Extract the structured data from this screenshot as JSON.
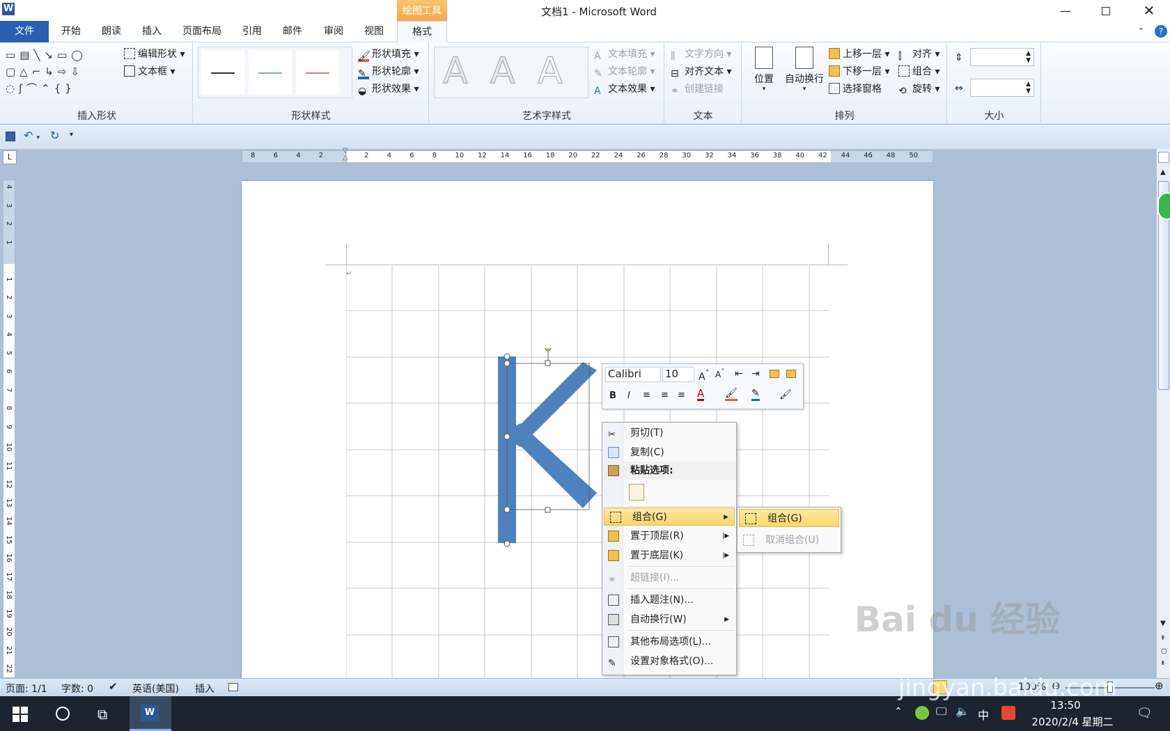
{
  "window": {
    "title": "文档1 - Microsoft Word",
    "context_tab_group": "绘图工具"
  },
  "tabs": [
    "文件",
    "开始",
    "朗读",
    "插入",
    "页面布局",
    "引用",
    "邮件",
    "审阅",
    "视图",
    "格式"
  ],
  "ribbon": {
    "insert_shapes": {
      "label": "插入形状",
      "edit_shape": "编辑形状",
      "text_box": "文本框"
    },
    "shape_styles": {
      "label": "形状样式",
      "fill": "形状填充",
      "outline": "形状轮廓",
      "effects": "形状效果"
    },
    "wordart": {
      "label": "艺术字样式",
      "glyph": "A",
      "fill": "文本填充",
      "outline": "文本轮廓",
      "effects": "文本效果"
    },
    "text": {
      "label": "文本",
      "direction": "文字方向",
      "align": "对齐文本",
      "link": "创建链接"
    },
    "arrange": {
      "label": "排列",
      "position": "位置",
      "wrap": "自动换行",
      "bring_forward": "上移一层",
      "send_backward": "下移一层",
      "selection_pane": "选择窗格",
      "align": "对齐",
      "group": "组合",
      "rotate": "旋转"
    },
    "size": {
      "label": "大小"
    }
  },
  "ruler": {
    "h_ticks": [
      "8",
      "6",
      "4",
      "2",
      "",
      "2",
      "4",
      "6",
      "8",
      "10",
      "12",
      "14",
      "16",
      "18",
      "20",
      "22",
      "24",
      "26",
      "28",
      "30",
      "32",
      "34",
      "36",
      "38",
      "40",
      "42",
      "44",
      "46",
      "48",
      "50"
    ],
    "v_ticks": [
      "4",
      "3",
      "2",
      "1",
      "",
      "1",
      "2",
      "3",
      "4",
      "5",
      "6",
      "7",
      "8",
      "9",
      "10",
      "11",
      "12",
      "13",
      "14",
      "15",
      "16",
      "17",
      "18",
      "19",
      "20",
      "21",
      "22"
    ]
  },
  "mini_toolbar": {
    "font": "Calibri",
    "size": "10"
  },
  "context_menu": {
    "items": [
      {
        "label": "剪切(T)",
        "disabled": false
      },
      {
        "label": "复制(C)",
        "disabled": false
      },
      {
        "label": "粘贴选项:",
        "disabled": false,
        "bold": true
      },
      {
        "label": "组合(G)",
        "disabled": false,
        "submenu": true,
        "highlight": true
      },
      {
        "label": "置于顶层(R)",
        "disabled": false,
        "submenu": true
      },
      {
        "label": "置于底层(K)",
        "disabled": false,
        "submenu": true
      },
      {
        "label": "超链接(I)...",
        "disabled": true
      },
      {
        "label": "插入题注(N)...",
        "disabled": false
      },
      {
        "label": "自动换行(W)",
        "disabled": false,
        "submenu": true
      },
      {
        "label": "其他布局选项(L)...",
        "disabled": false
      },
      {
        "label": "设置对象格式(O)...",
        "disabled": false
      }
    ],
    "submenu": [
      {
        "label": "组合(G)",
        "disabled": false
      },
      {
        "label": "取消组合(U)",
        "disabled": true
      }
    ]
  },
  "status": {
    "page": "页面: 1/1",
    "words": "字数: 0",
    "language": "英语(美国)",
    "mode": "插入",
    "zoom": "100%"
  },
  "taskbar": {
    "time": "13:50",
    "date": "2020/2/4 星期二",
    "ime": "中"
  },
  "watermark": {
    "text": "Bai du 经验",
    "url": "jingyan.baidu.com"
  },
  "colors": {
    "accent": "#2a5fb0",
    "shape": "#4f81bd",
    "highlight": "#fbd769"
  }
}
